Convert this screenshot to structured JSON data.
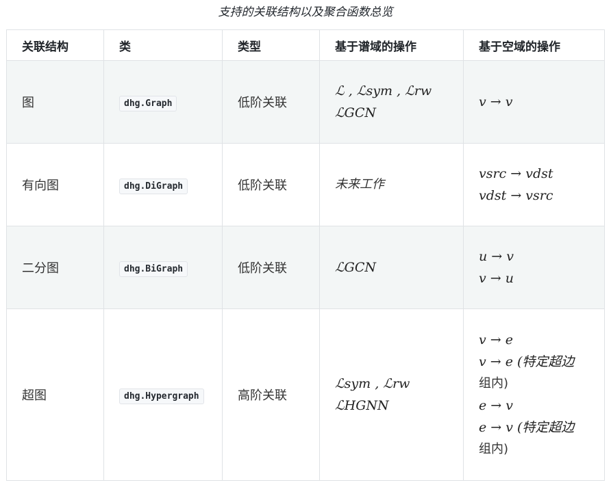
{
  "caption": "支持的关联结构以及聚合函数总览",
  "headers": [
    "关联结构",
    "类",
    "类型",
    "基于谱域的操作",
    "基于空域的操作"
  ],
  "rows": [
    {
      "structure": "图",
      "class": "dhg.Graph",
      "type": "低阶关联",
      "spectral": [
        "ℒ , ℒsym , ℒrw",
        "ℒGCN"
      ],
      "spatial": [
        "v → v"
      ]
    },
    {
      "structure": "有向图",
      "class": "dhg.DiGraph",
      "type": "低阶关联",
      "spectral": [
        "未来工作"
      ],
      "spatial": [
        "vsrc → vdst",
        "vdst → vsrc"
      ]
    },
    {
      "structure": "二分图",
      "class": "dhg.BiGraph",
      "type": "低阶关联",
      "spectral": [
        "ℒGCN"
      ],
      "spatial": [
        "u → v",
        "v → u"
      ]
    },
    {
      "structure": "超图",
      "class": "dhg.Hypergraph",
      "type": "高阶关联",
      "spectral": [
        "ℒsym , ℒrw",
        "ℒHGNN"
      ],
      "spatial": [
        "v → e",
        "v → e (特定超边",
        "组内)",
        "e → v",
        "e → v (特定超边",
        "组内)"
      ]
    }
  ]
}
